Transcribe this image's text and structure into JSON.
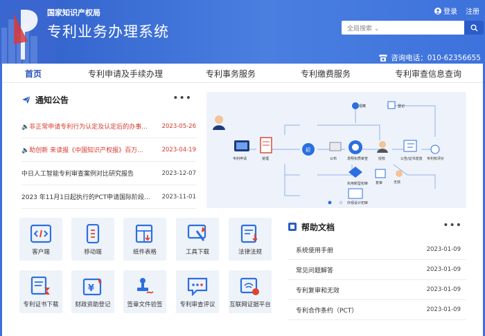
{
  "header": {
    "agency": "国家知识产权局",
    "system_name": "专利业务办理系统",
    "login": "登录",
    "register": "注册",
    "search_scope": "全局搜索",
    "search_placeholder": "",
    "hotline": "咨询电话：010-62356655"
  },
  "nav": [
    {
      "label": "首页",
      "active": true
    },
    {
      "label": "专利申请及手续办理"
    },
    {
      "label": "专利事务服务"
    },
    {
      "label": "专利缴费服务"
    },
    {
      "label": "专利审查信息查询"
    }
  ],
  "notice": {
    "title": "通知公告",
    "more": "•••",
    "items": [
      {
        "text": "非正常申请专利行为认定及认定后的办事...",
        "date": "2023-05-26",
        "hot": true
      },
      {
        "text": "助创新 来读报《中国知识产权报》百万...",
        "date": "2023-04-19",
        "hot": true
      },
      {
        "text": "中日人工智能专利审查案例对比研究报告",
        "date": "2023-12-07"
      },
      {
        "text": "2023 年11月1日起执行的PCT申请国际阶段...",
        "date": "2023-11-01"
      }
    ]
  },
  "flow": {
    "labels": [
      "专利申请",
      "受理",
      "初",
      "公布",
      "发明实质审查",
      "授权",
      "公告/证书发放",
      "实用新型初审",
      "外观设计初审",
      "复审",
      "专利权评价",
      "无效",
      "视察",
      "登记"
    ]
  },
  "tiles": [
    {
      "label": "客户端",
      "icon": "code-icon"
    },
    {
      "label": "移动端",
      "icon": "mobile-icon"
    },
    {
      "label": "纸件表格",
      "icon": "form-icon"
    },
    {
      "label": "工具下载",
      "icon": "tools-icon"
    },
    {
      "label": "法律法规",
      "icon": "law-icon"
    },
    {
      "label": "专利证书下载",
      "icon": "certificate-icon"
    },
    {
      "label": "财政资助登记",
      "icon": "finance-icon"
    },
    {
      "label": "签章文件验签",
      "icon": "stamp-icon"
    },
    {
      "label": "专利审查评议",
      "icon": "comment-icon"
    },
    {
      "label": "互联网证据平台",
      "icon": "evidence-icon"
    }
  ],
  "help": {
    "title": "帮助文档",
    "more": "•••",
    "items": [
      {
        "text": "系统使用手册",
        "date": "2023-01-09"
      },
      {
        "text": "常见问题解答",
        "date": "2023-01-09"
      },
      {
        "text": "专利复审和无效",
        "date": "2023-01-09"
      },
      {
        "text": "专利合作条约（PCT）",
        "date": "2023-01-09"
      }
    ]
  },
  "colors": {
    "brand": "#2f5fc9",
    "hot": "#d8372b",
    "accent": "#2550b8"
  }
}
